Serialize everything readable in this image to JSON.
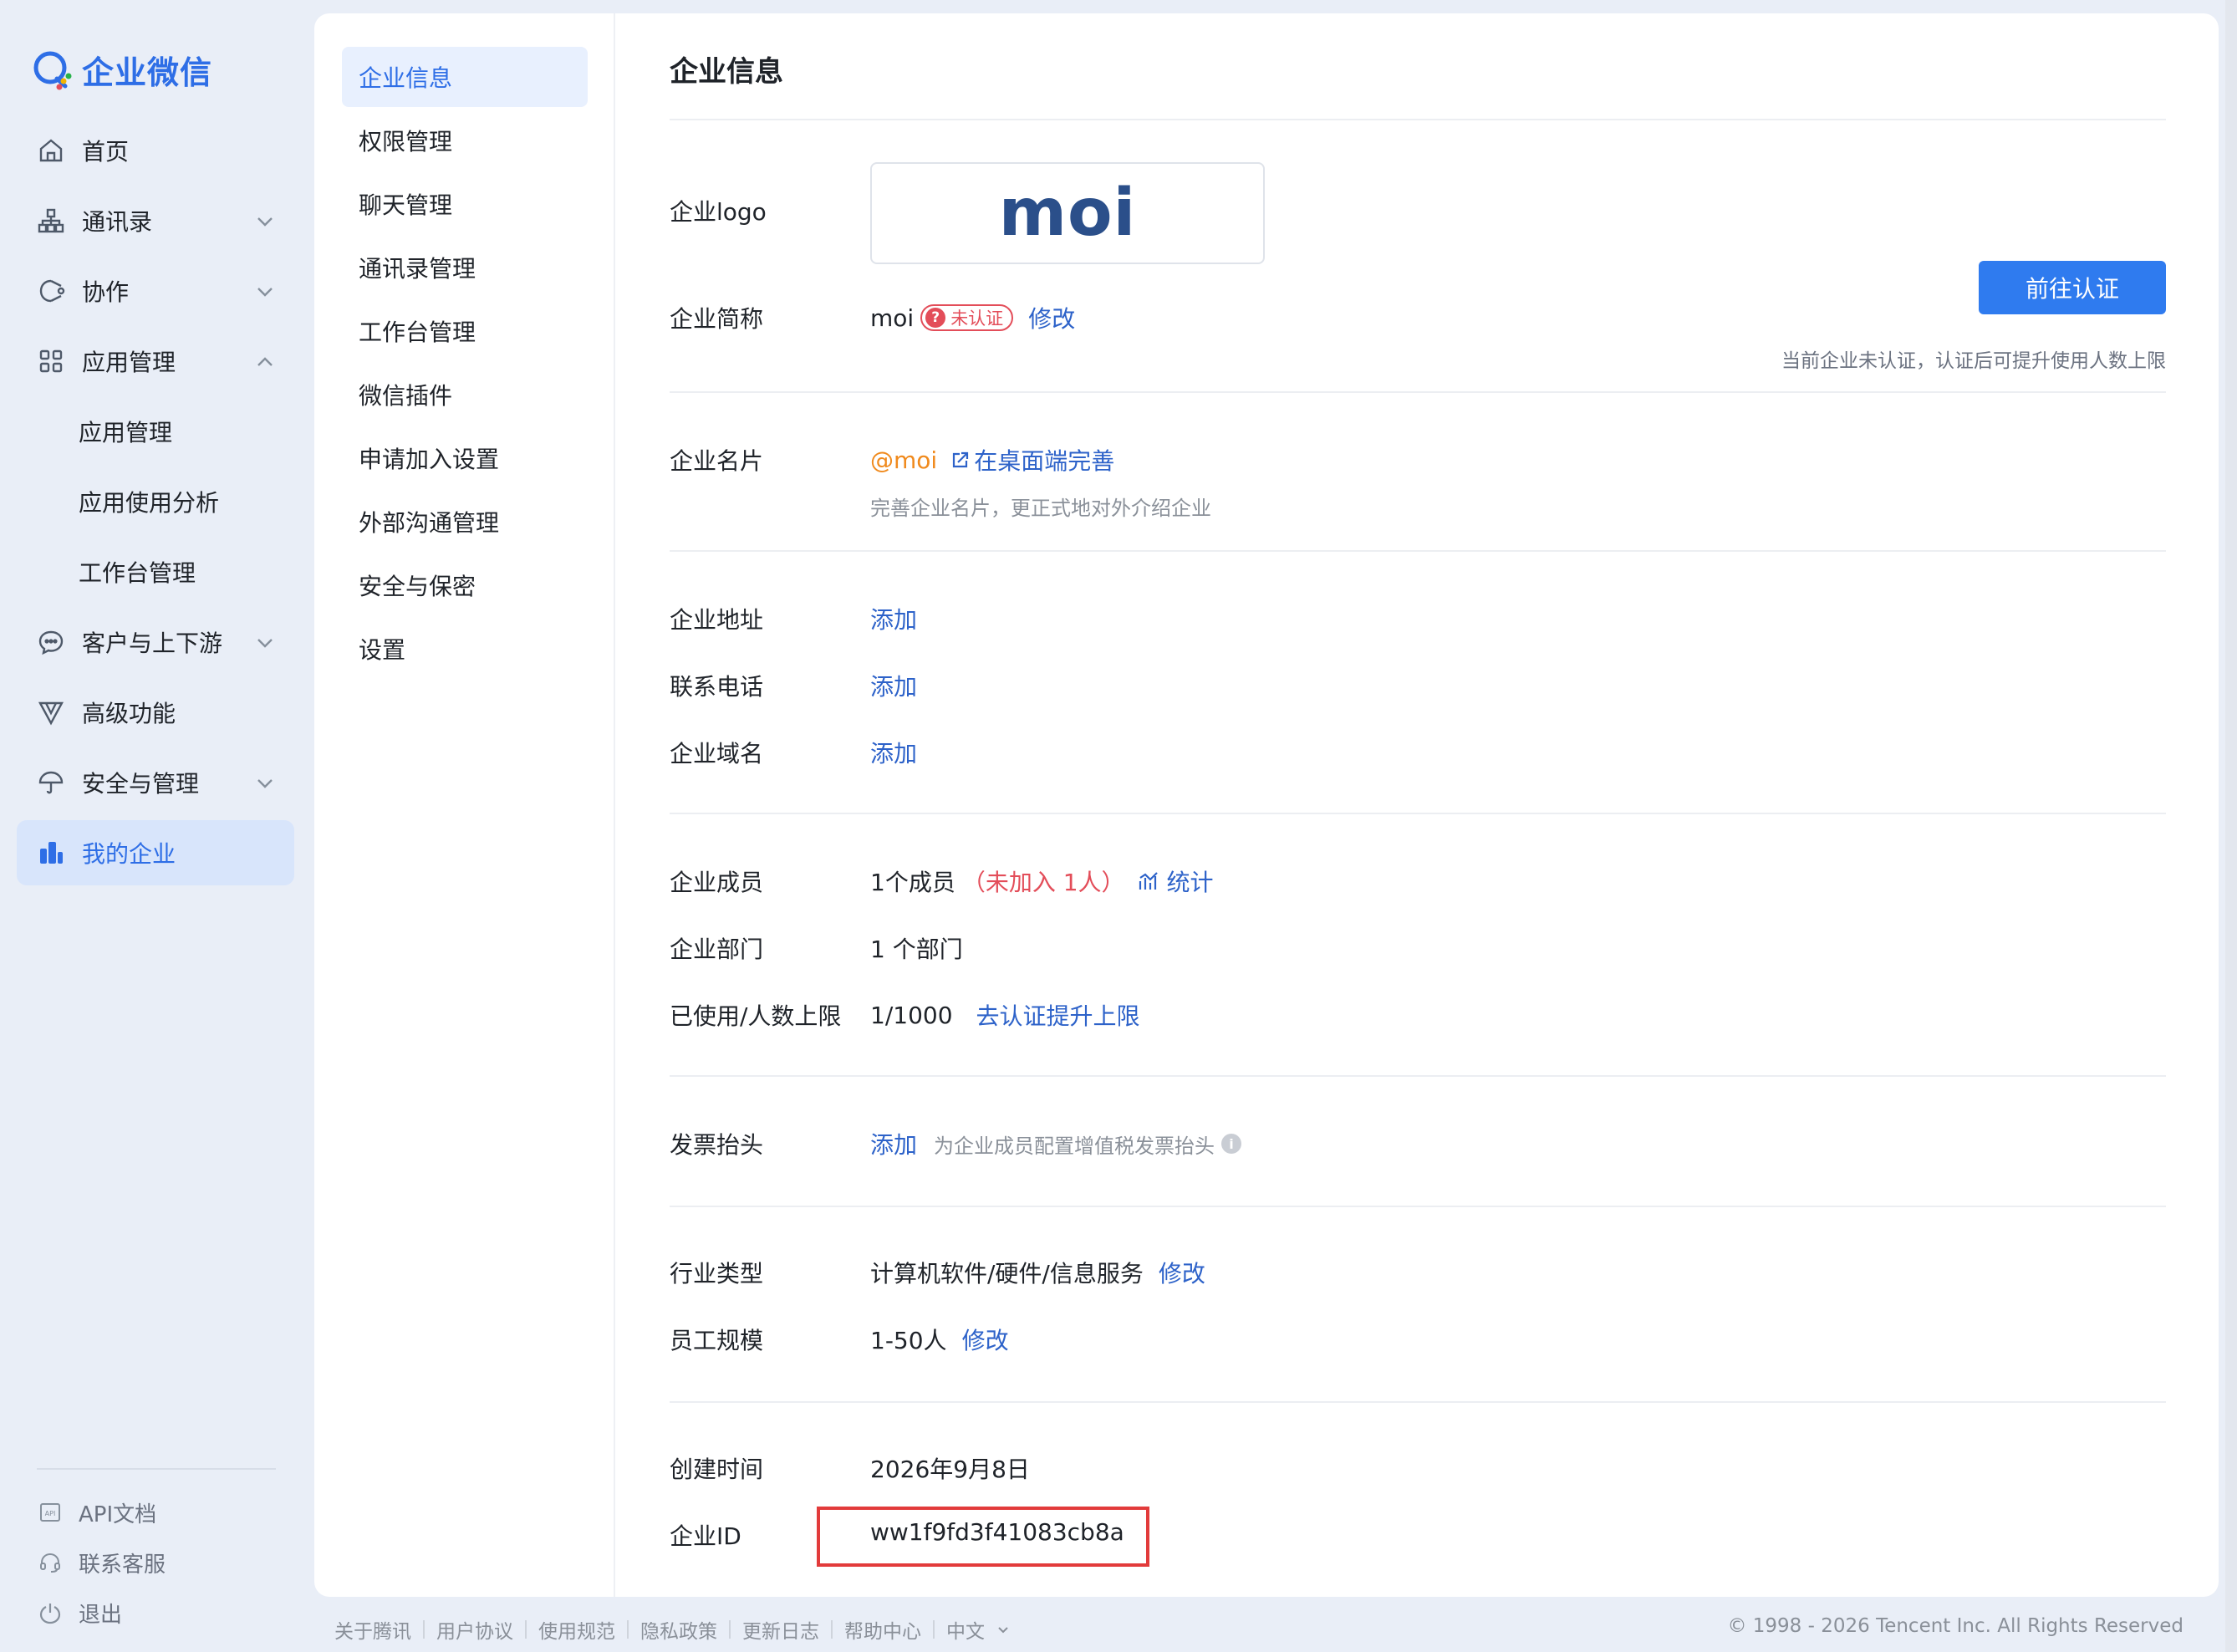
{
  "brand": {
    "name": "企业微信"
  },
  "nav": {
    "items": [
      {
        "label": "首页"
      },
      {
        "label": "通讯录"
      },
      {
        "label": "协作"
      },
      {
        "label": "应用管理"
      },
      {
        "label": "应用管理"
      },
      {
        "label": "应用使用分析"
      },
      {
        "label": "工作台管理"
      },
      {
        "label": "客户与上下游"
      },
      {
        "label": "高级功能"
      },
      {
        "label": "安全与管理"
      },
      {
        "label": "我的企业"
      }
    ],
    "footer": [
      {
        "label": "API文档"
      },
      {
        "label": "联系客服"
      },
      {
        "label": "退出"
      }
    ]
  },
  "subnav": {
    "items": [
      {
        "label": "企业信息"
      },
      {
        "label": "权限管理"
      },
      {
        "label": "聊天管理"
      },
      {
        "label": "通讯录管理"
      },
      {
        "label": "工作台管理"
      },
      {
        "label": "微信插件"
      },
      {
        "label": "申请加入设置"
      },
      {
        "label": "外部沟通管理"
      },
      {
        "label": "安全与保密"
      },
      {
        "label": "设置"
      }
    ]
  },
  "page": {
    "title": "企业信息",
    "logo": {
      "label": "企业logo",
      "text": "moi"
    },
    "short_name": {
      "label": "企业简称",
      "value": "moi",
      "badge_icon": "?",
      "badge": "未认证",
      "edit": "修改"
    },
    "verify": {
      "button": "前往认证",
      "hint": "当前企业未认证，认证后可提升使用人数上限"
    },
    "card": {
      "label": "企业名片",
      "handle": "@moi",
      "link": "在桌面端完善",
      "hint": "完善企业名片，更正式地对外介绍企业"
    },
    "address": {
      "label": "企业地址",
      "action": "添加"
    },
    "phone": {
      "label": "联系电话",
      "action": "添加"
    },
    "domain": {
      "label": "企业域名",
      "action": "添加"
    },
    "members": {
      "label": "企业成员",
      "value": "1个成员",
      "pending": "（未加入 1人）",
      "stats": "统计"
    },
    "departments": {
      "label": "企业部门",
      "value": "1 个部门"
    },
    "quota": {
      "label": "已使用/人数上限",
      "value": "1/1000",
      "action": "去认证提升上限"
    },
    "invoice": {
      "label": "发票抬头",
      "action": "添加",
      "hint": "为企业成员配置增值税发票抬头",
      "info_icon": "i"
    },
    "industry": {
      "label": "行业类型",
      "value": "计算机软件/硬件/信息服务",
      "edit": "修改"
    },
    "scale": {
      "label": "员工规模",
      "value": "1-50人",
      "edit": "修改"
    },
    "created": {
      "label": "创建时间",
      "value": "2026年9月8日"
    },
    "corp_id": {
      "label": "企业ID",
      "value": "ww1f9fd3f41083cb8a"
    }
  },
  "footer": {
    "links": [
      "关于腾讯",
      "用户协议",
      "使用规范",
      "隐私政策",
      "更新日志",
      "帮助中心",
      "中文"
    ],
    "copyright": "© 1998 - 2026 Tencent Inc. All Rights Reserved"
  },
  "colors": {
    "accent": "#2e6ee6",
    "link": "#2d62c9",
    "warning": "#e34d59",
    "highlight": "#e23b3b"
  }
}
